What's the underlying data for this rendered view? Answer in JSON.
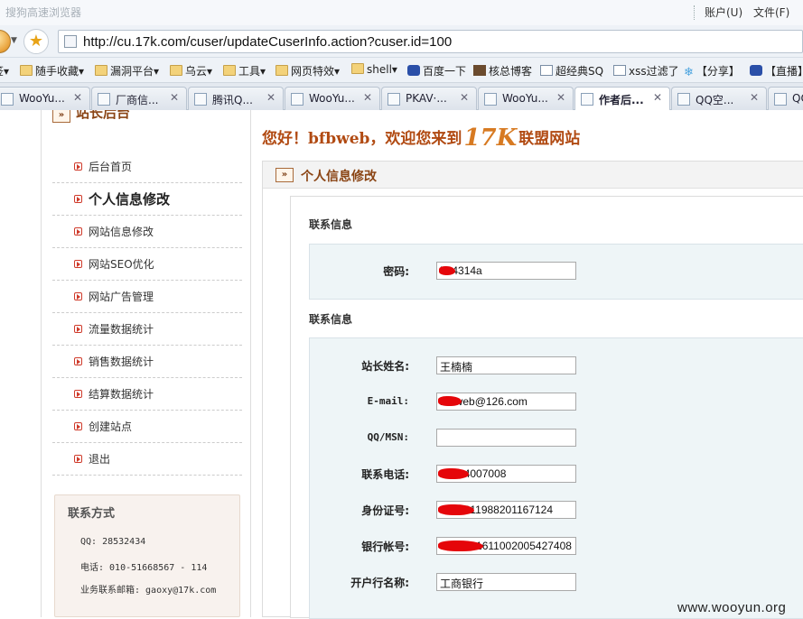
{
  "window": {
    "title": "搜狗高速浏览器",
    "menus": [
      "账户(U)",
      "文件(F)"
    ]
  },
  "address_bar": {
    "url": "http://cu.17k.com/cuser/updateCuserInfo.action?cuser.id=100"
  },
  "favorites": [
    {
      "label": "签▾",
      "icon": "folder-icon"
    },
    {
      "label": "随手收藏▾",
      "icon": "folder-icon"
    },
    {
      "label": "漏洞平台▾",
      "icon": "folder-icon"
    },
    {
      "label": "乌云▾",
      "icon": "folder-icon"
    },
    {
      "label": "工具▾",
      "icon": "folder-icon"
    },
    {
      "label": "网页特效▾",
      "icon": "folder-icon"
    },
    {
      "label": "shell▾",
      "icon": "folder-icon"
    },
    {
      "label": "百度一下",
      "icon": "paw-icon"
    },
    {
      "label": "核总博客",
      "icon": "image-icon"
    },
    {
      "label": "超经典SQ",
      "icon": "page-icon"
    },
    {
      "label": "xss过滤了",
      "icon": "page-icon"
    },
    {
      "label": "【分享】",
      "icon": "snowflake-icon"
    },
    {
      "label": "【直播】",
      "icon": "paw-icon"
    }
  ],
  "tabs": [
    {
      "label": "WooYu...",
      "active": false
    },
    {
      "label": "厂商信...",
      "active": false
    },
    {
      "label": "腾讯Q...",
      "active": false
    },
    {
      "label": "WooYu...",
      "active": false
    },
    {
      "label": "PKAV·...",
      "active": false
    },
    {
      "label": "WooYu...",
      "active": false
    },
    {
      "label": "作者后...",
      "active": true
    },
    {
      "label": "QQ空...",
      "active": false
    },
    {
      "label": "QQ",
      "active": false
    }
  ],
  "sidebar": {
    "heading": "站长后台",
    "items": [
      {
        "label": "后台首页"
      },
      {
        "label": "个人信息修改",
        "current": true
      },
      {
        "label": "网站信息修改"
      },
      {
        "label": "网站SEO优化"
      },
      {
        "label": "网站广告管理"
      },
      {
        "label": "流量数据统计"
      },
      {
        "label": "销售数据统计"
      },
      {
        "label": "结算数据统计"
      },
      {
        "label": "创建站点"
      },
      {
        "label": "退出"
      }
    ],
    "contact": {
      "heading": "联系方式",
      "qq": "QQ: 28532434",
      "phone": "电话: 010-51668567 - 114",
      "email": "业务联系邮箱: gaoxy@17k.com"
    }
  },
  "main": {
    "greeting_pre": "您好！bfbweb，欢迎您来到",
    "brand": "17K",
    "greeting_post": "联盟网站",
    "panel_title": "个人信息修改",
    "section1": {
      "title": "联系信息",
      "fields": [
        {
          "label": "密码:",
          "value": "524314a",
          "redacted": true
        }
      ]
    },
    "section2": {
      "title": "联系信息",
      "fields": [
        {
          "label": "站长姓名:",
          "value": "王楠楠"
        },
        {
          "label": "E-mail:",
          "value": "bfbweb@126.com",
          "redacted": true
        },
        {
          "label": "QQ/MSN:",
          "value": ""
        },
        {
          "label": "联系电话:",
          "value": "13264007008",
          "redacted": true
        },
        {
          "label": "身份证号:",
          "value": "3714211988201167124",
          "redacted": true
        },
        {
          "label": "银行帐号:",
          "value": "9558821611002005427408",
          "redacted": true
        },
        {
          "label": "开户行名称:",
          "value": "工商银行"
        }
      ]
    }
  },
  "watermark": "www.wooyun.org"
}
